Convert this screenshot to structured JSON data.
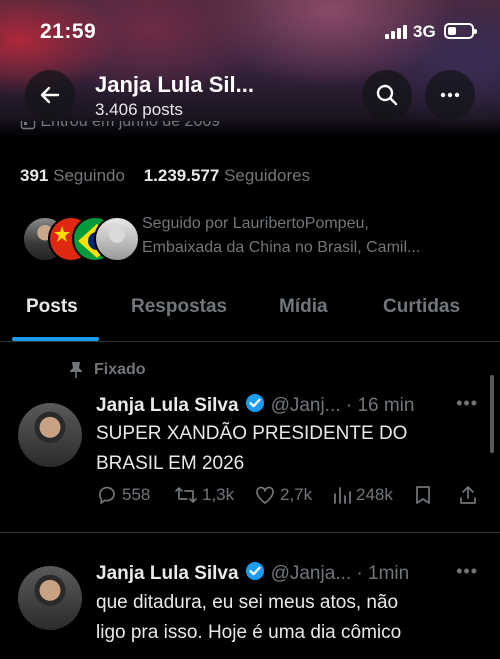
{
  "status": {
    "time": "21:59",
    "network": "3G"
  },
  "header": {
    "name": "Janja Lula Sil...",
    "posts_count": "3.406 posts",
    "joined": "Entrou em junho de 2009"
  },
  "stats": {
    "following_count": "391",
    "following_label": "Seguindo",
    "followers_count": "1.239.577",
    "followers_label": "Seguidores"
  },
  "followed_by": {
    "line1": "Seguido por LauribertoPompeu,",
    "line2": "Embaixada da China no Brasil, Camil..."
  },
  "tabs": [
    {
      "label": "Posts",
      "active": true
    },
    {
      "label": "Respostas",
      "active": false
    },
    {
      "label": "Mídia",
      "active": false
    },
    {
      "label": "Curtidas",
      "active": false
    }
  ],
  "tweets": [
    {
      "pinned_label": "Fixado",
      "name": "Janja Lula Silva",
      "handle_time": "@Janj... · 16 min",
      "text_line1": "SUPER XANDÃO PRESIDENTE DO",
      "text_line2": "BRASIL EM 2026",
      "replies": "558",
      "reposts": "1,3k",
      "likes": "2,7k",
      "views": "248k"
    },
    {
      "name": "Janja Lula Silva",
      "handle_time": "@Janja... · 1min",
      "text_line1": "que ditadura, eu sei meus atos, não",
      "text_line2": "ligo pra isso. Hoje é uma dia cômico"
    }
  ],
  "colors": {
    "accent": "#1d9bf0",
    "muted": "#71767b",
    "text": "#e7e9ea",
    "background": "#000000"
  }
}
